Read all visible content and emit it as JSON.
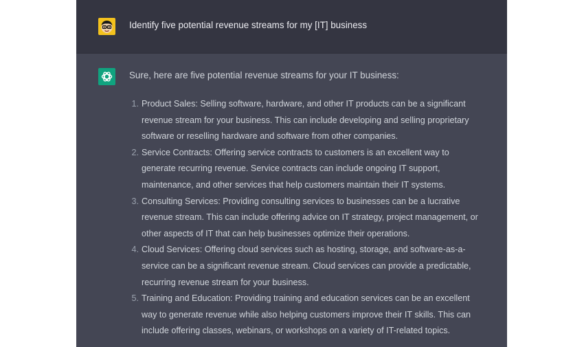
{
  "colors": {
    "user_row_bg": "#343541",
    "assistant_row_bg": "#444654",
    "user_avatar_bg": "#f4c21d",
    "assistant_avatar_bg": "#10a37f",
    "text": "#d1d5db"
  },
  "conversation": {
    "user": {
      "avatar_icon": "cartoon-face-avatar-icon",
      "message": "Identify five potential revenue streams for my [IT] business"
    },
    "assistant": {
      "avatar_icon": "openai-logo-icon",
      "intro": "Sure, here are five potential revenue streams for your IT business:",
      "items": [
        {
          "number": "1.",
          "lines": [
            "Product Sales: Selling software, hardware, and other IT products can be a significant",
            "revenue stream for your business. This can include developing and selling proprietary",
            "software or reselling hardware and software from other companies."
          ]
        },
        {
          "number": "2.",
          "lines": [
            "Service Contracts: Offering service contracts to customers is an excellent way to",
            "generate recurring revenue. Service contracts can include ongoing IT support,",
            "maintenance, and other services that help customers maintain their IT systems."
          ]
        },
        {
          "number": "3.",
          "lines": [
            "Consulting Services: Providing consulting services to businesses can be a lucrative",
            "revenue stream. This can include offering advice on IT strategy, project management, or",
            "other aspects of IT that can help businesses optimize their operations."
          ]
        },
        {
          "number": "4.",
          "lines": [
            "Cloud Services: Offering cloud services such as hosting, storage, and software-as-a-",
            "service can be a significant revenue stream. Cloud services can provide a predictable,",
            "recurring revenue stream for your business."
          ]
        },
        {
          "number": "5.",
          "lines": [
            "Training and Education: Providing training and education services can be an excellent",
            "way to generate revenue while also helping customers improve their IT skills. This can",
            "include offering classes, webinars, or workshops on a variety of IT-related topics."
          ]
        }
      ]
    }
  }
}
